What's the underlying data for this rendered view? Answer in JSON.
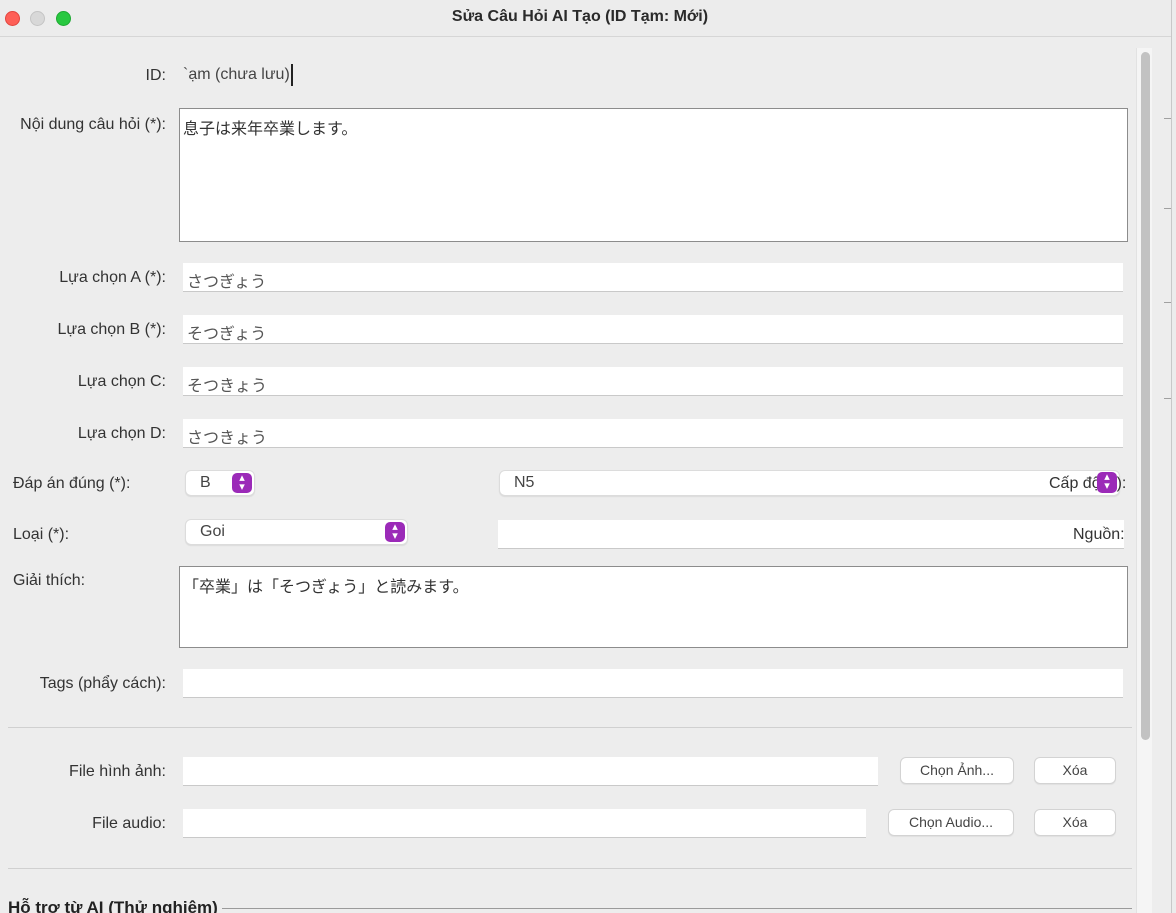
{
  "window": {
    "title": "Sửa Câu Hỏi AI Tạo (ID Tạm: Mới)"
  },
  "form": {
    "id": {
      "label": "ID:",
      "value": "`ạm (chưa lưu)"
    },
    "question": {
      "label": "Nội dung câu hỏi (*):",
      "value": "息子は来年卒業します。"
    },
    "option_a": {
      "label": "Lựa chọn A (*):",
      "value": "さつぎょう"
    },
    "option_b": {
      "label": "Lựa chọn B (*):",
      "value": "そつぎょう"
    },
    "option_c": {
      "label": "Lựa chọn C:",
      "value": "そつきょう"
    },
    "option_d": {
      "label": "Lựa chọn D:",
      "value": "さつきょう"
    },
    "answer": {
      "label": "Đáp án đúng (*):",
      "selected": "B"
    },
    "level": {
      "label": "Cấp độ (*):",
      "selected": "N5"
    },
    "type": {
      "label": "Loại (*):",
      "selected": "Goi"
    },
    "source": {
      "label": "Nguồn:",
      "value": ""
    },
    "explanation": {
      "label": "Giải thích:",
      "value": "「卒業」は「そつぎょう」と読みます。"
    },
    "tags": {
      "label": "Tags (phẩy cách):",
      "value": ""
    },
    "image_file": {
      "label": "File hình ảnh:",
      "value": "",
      "choose_label": "Chọn Ảnh...",
      "clear_label": "Xóa"
    },
    "audio_file": {
      "label": "File audio:",
      "value": "",
      "choose_label": "Chọn Audio...",
      "clear_label": "Xóa"
    },
    "ai_section": {
      "label": "Hỗ trợ từ AI (Thử nghiệm)"
    }
  },
  "icons": {
    "close": "close-icon",
    "minimize": "minimize-icon",
    "maximize": "maximize-icon",
    "combo_arrow": "up-down-chevron-icon"
  },
  "colors": {
    "accent": "#9b2ab8",
    "close": "#fe5f57",
    "maximize": "#28c840"
  }
}
